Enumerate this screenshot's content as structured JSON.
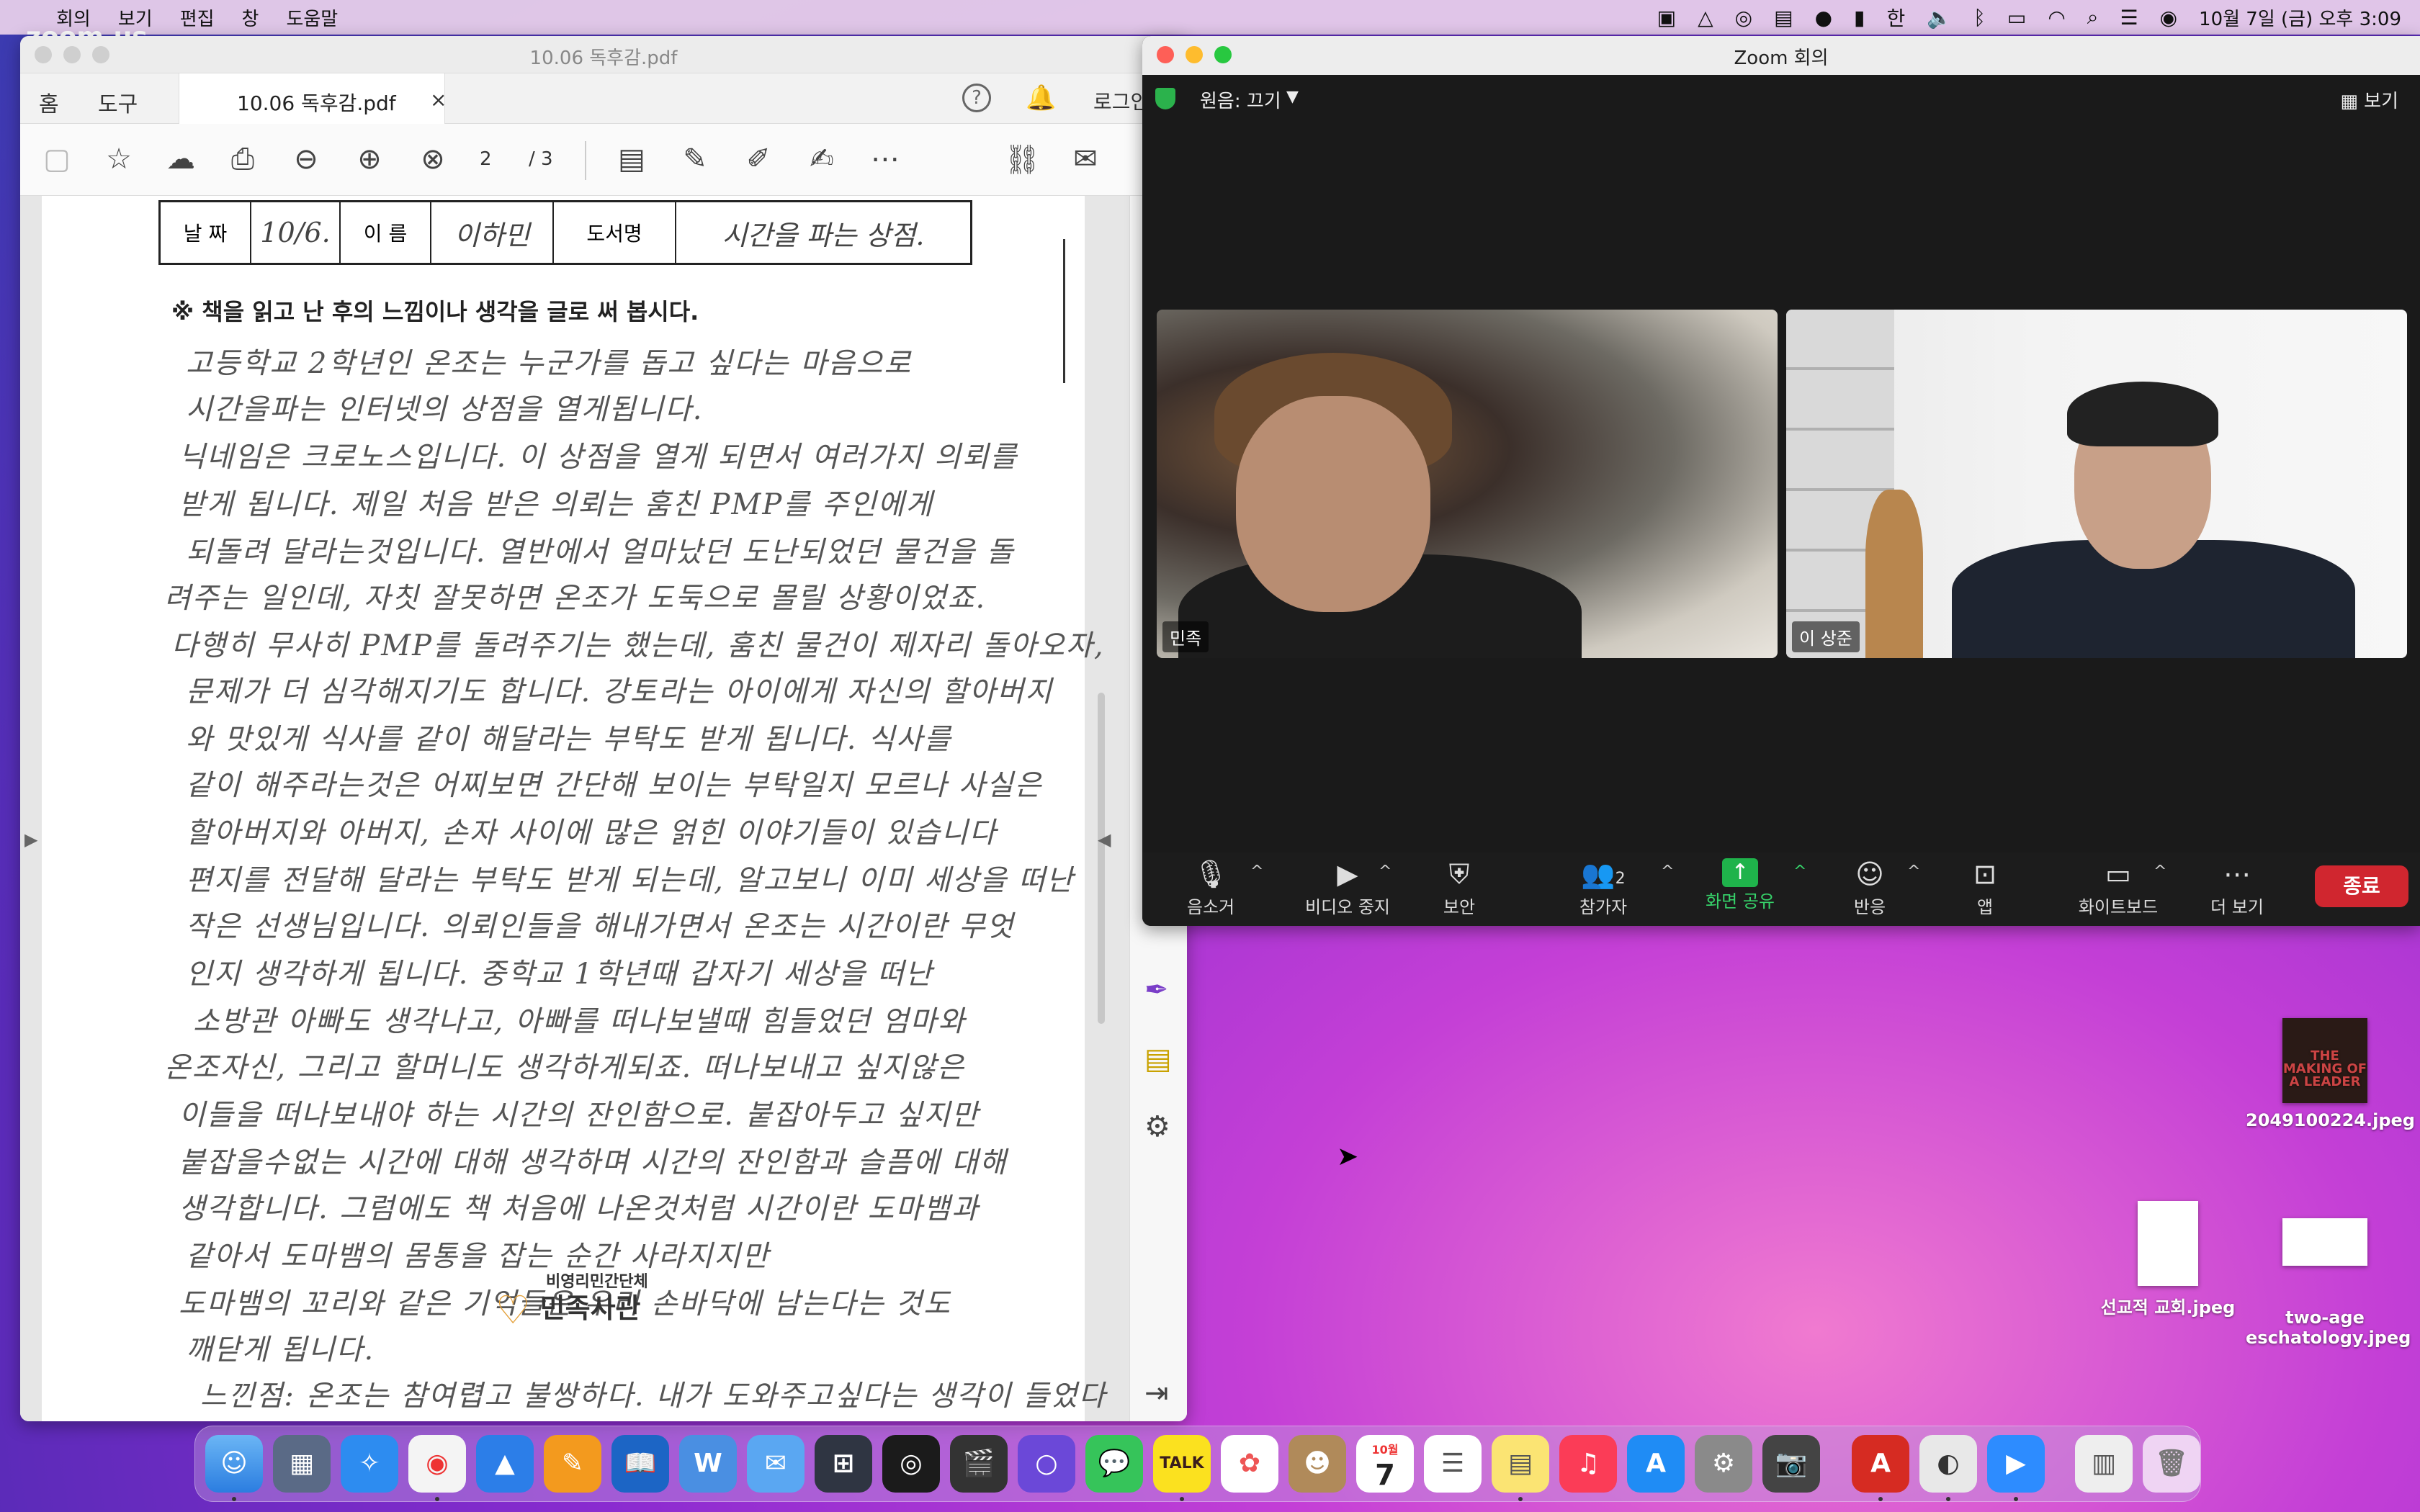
{
  "menubar": {
    "app": "zoom.us",
    "items": [
      "회의",
      "보기",
      "편집",
      "창",
      "도움말"
    ],
    "datetime": "10월 7일 (금) 오후 3:09"
  },
  "acrobat": {
    "window_title": "10.06 독후감.pdf",
    "tab_home": "홈",
    "tab_tools": "도구",
    "tab_doc": "10.06 독후감.pdf",
    "tab_close": "×",
    "help": "?",
    "login": "로그인",
    "page_current": "2",
    "page_total": "/ 3",
    "form": {
      "date_label": "날 짜",
      "date_value": "10/6.",
      "name_label": "이 름",
      "name_value": "이하민",
      "book_label": "도서명",
      "book_value": "시간을 파는 상점."
    },
    "instruction": "※ 책을 읽고 난 후의 느낌이나 생각을 글로 써 봅시다.",
    "lines": [
      "고등학교 2학년인 온조는 누군가를 돕고 싶다는 마음으로",
      "시간을파는 인터넷의 상점을 열게됩니다.",
      "닉네임은 크로노스입니다. 이 상점을 열게 되면서 여러가지 의뢰를",
      "받게 됩니다. 제일 처음 받은 의뢰는 훔친 PMP를 주인에게",
      "되돌려 달라는것입니다. 열반에서 얼마났던 도난되었던 물건을 돌",
      "려주는 일인데, 자칫 잘못하면 온조가 도둑으로 몰릴 상황이었죠.",
      "다행히 무사히 PMP를 돌려주기는 했는데, 훔친 물건이 제자리 돌아오자,",
      "문제가 더 심각해지기도 합니다. 강토라는 아이에게 자신의 할아버지",
      "와 맛있게 식사를 같이 해달라는 부탁도 받게 됩니다. 식사를",
      "같이 해주라는것은 어찌보면 간단해 보이는 부탁일지 모르나 사실은",
      "할아버지와 아버지, 손자 사이에 많은 얽힌 이야기들이 있습니다",
      "편지를 전달해 달라는 부탁도 받게 되는데, 알고보니 이미 세상을 떠난",
      "작은 선생님입니다. 의뢰인들을 해내가면서 온조는 시간이란 무엇",
      "인지 생각하게 됩니다. 중학교 1학년때 갑자기 세상을 떠난",
      "소방관 아빠도 생각나고, 아빠를 떠나보낼때 힘들었던 엄마와",
      "온조자신, 그리고 할머니도 생각하게되죠. 떠나보내고 싶지않은",
      "이들을 떠나보내야 하는 시간의 잔인함으로. 붙잡아두고 싶지만",
      "붙잡을수없는 시간에 대해 생각하며 시간의 잔인함과 슬픔에 대해",
      "생각합니다. 그럼에도 책 처음에 나온것처럼 시간이란 도마뱀과",
      "같아서 도마뱀의 몸통을 잡는 순간 사라지지만",
      "도마뱀의 꼬리와 같은 기억들은 우리 손바닥에 남는다는 것도",
      "깨닫게 됩니다.",
      "느낀점: 온조는 참여렵고 불쌍하다. 내가 도와주고싶다는 생각이 들었다"
    ],
    "watermark_small": "비영리민간단체",
    "watermark_big": "민족사관"
  },
  "zoom": {
    "window_title": "Zoom 회의",
    "original_sound": "원음: 끄기",
    "view": "보기",
    "participants": [
      {
        "name": "민족"
      },
      {
        "name": "이 상준"
      }
    ],
    "controls": [
      {
        "label": "음소거",
        "icon": "microphone-icon"
      },
      {
        "label": "비디오 중지",
        "icon": "video-camera-icon"
      },
      {
        "label": "보안",
        "icon": "shield-icon"
      },
      {
        "label": "참가자",
        "icon": "participants-icon",
        "count": "2"
      },
      {
        "label": "화면 공유",
        "icon": "share-screen-icon"
      },
      {
        "label": "반응",
        "icon": "emoji-icon"
      },
      {
        "label": "앱",
        "icon": "apps-icon"
      },
      {
        "label": "화이트보드",
        "icon": "whiteboard-icon"
      },
      {
        "label": "더 보기",
        "icon": "more-icon"
      }
    ],
    "end": "종료"
  },
  "desktop": {
    "files": [
      {
        "name": "2049100224.jpeg",
        "book_title": "THE MAKING OF A LEADER"
      },
      {
        "name": "선교적 교회.jpeg"
      },
      {
        "name": "two-age\neschatology.jpeg"
      }
    ]
  },
  "dock": {
    "calendar_month": "10월",
    "calendar_day": "7",
    "talk": "TALK"
  }
}
